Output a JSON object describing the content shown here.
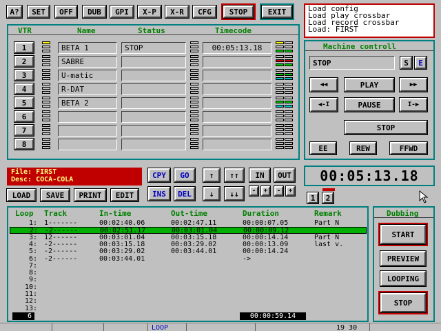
{
  "toolbar": {
    "help": "A?",
    "set": "SET",
    "off": "OFF",
    "dub": "DUB",
    "gpi": "GPI",
    "xp": "X-P",
    "xr": "X-R",
    "cfg": "CFG",
    "stop": "STOP",
    "exit": "EXIT"
  },
  "messages": [
    "Load config",
    "Load play crossbar",
    "Load record crossbar",
    "Load: FIRST"
  ],
  "vtr_table": {
    "headers": {
      "vtr": "VTR",
      "name": "Name",
      "status": "Status",
      "timecode": "Timecode"
    },
    "rows": [
      {
        "num": "1",
        "name": "BETA 1",
        "status": "STOP",
        "timecode": "00:05:13.18"
      },
      {
        "num": "2",
        "name": "SABRE",
        "status": "",
        "timecode": ""
      },
      {
        "num": "3",
        "name": "U-matic",
        "status": "",
        "timecode": ""
      },
      {
        "num": "4",
        "name": "R-DAT",
        "status": "",
        "timecode": ""
      },
      {
        "num": "5",
        "name": "BETA 2",
        "status": "",
        "timecode": ""
      },
      {
        "num": "6",
        "name": "",
        "status": "",
        "timecode": ""
      },
      {
        "num": "7",
        "name": "",
        "status": "",
        "timecode": ""
      },
      {
        "num": "8",
        "name": "",
        "status": "",
        "timecode": ""
      }
    ]
  },
  "machine": {
    "title": "Machine controll",
    "status": "STOP",
    "s_label": "S",
    "e_label": "E",
    "rew_icon": "◀◀",
    "play": "PLAY",
    "ffwd_icon": "▶▶",
    "step_back": "◀-I",
    "pause": "PAUSE",
    "step_fwd": "I-▶",
    "stop": "STOP",
    "ee": "EE",
    "rew": "REW",
    "ffwd": "FFWD"
  },
  "file": {
    "file_line": "File: FIRST",
    "desc_line": "Desc: COCA-COLA"
  },
  "edit_buttons": {
    "cpy": "CPY",
    "go": "GO",
    "ins": "INS",
    "del": "DEL",
    "up": "↑",
    "upup": "↑↑",
    "down": "↓",
    "downdown": "↓↓",
    "in": "IN",
    "out": "OUT",
    "minus1": "-",
    "plus1": "+",
    "minus2": "-",
    "plus2": "+",
    "load": "LOAD",
    "save": "SAVE",
    "print": "PRINT",
    "edit": "EDIT"
  },
  "timecode_big": "00:05:13.18",
  "pages": [
    "1",
    "2"
  ],
  "list": {
    "headers": {
      "loop": "Loop",
      "track": "Track",
      "in": "In-time",
      "out": "Out-time",
      "dur": "Duration",
      "remark": "Remark"
    },
    "rows": [
      {
        "num": "1:",
        "track": "1-------",
        "in": "00:02:40.06",
        "out": "00:02:47.11",
        "dur": "00:00:07.05",
        "remark": "Part N"
      },
      {
        "num": "2:",
        "track": "-2------",
        "in": "00:02:51.17",
        "out": "00:03:01.04",
        "dur": "00:00:09.12",
        "remark": ""
      },
      {
        "num": "3:",
        "track": "12------",
        "in": "00:03:01.04",
        "out": "00:03:15.18",
        "dur": "00:00:14.14",
        "remark": "Part N"
      },
      {
        "num": "4:",
        "track": "-2------",
        "in": "00:03:15.18",
        "out": "00:03:29.02",
        "dur": "00:00:13.09",
        "remark": "last v."
      },
      {
        "num": "5:",
        "track": "-2------",
        "in": "00:03:29.02",
        "out": "00:03:44.01",
        "dur": "00:00:14.24",
        "remark": ""
      },
      {
        "num": "6:",
        "track": "-2------",
        "in": "00:03:44.01",
        "out": "",
        "dur": "->",
        "remark": ""
      },
      {
        "num": "7:",
        "track": "",
        "in": "",
        "out": "",
        "dur": "",
        "remark": ""
      },
      {
        "num": "8:",
        "track": "",
        "in": "",
        "out": "",
        "dur": "",
        "remark": ""
      },
      {
        "num": "9:",
        "track": "",
        "in": "",
        "out": "",
        "dur": "",
        "remark": ""
      },
      {
        "num": "10:",
        "track": "",
        "in": "",
        "out": "",
        "dur": "",
        "remark": ""
      },
      {
        "num": "11:",
        "track": "",
        "in": "",
        "out": "",
        "dur": "",
        "remark": ""
      },
      {
        "num": "12:",
        "track": "",
        "in": "",
        "out": "",
        "dur": "",
        "remark": ""
      },
      {
        "num": "13:",
        "track": "",
        "in": "",
        "out": "",
        "dur": "",
        "remark": ""
      }
    ],
    "count": "6",
    "total": "00:00:59.14"
  },
  "dubbing": {
    "title": "Dubbing",
    "start": "START",
    "preview": "PREVIEW",
    "looping": "LOOPING",
    "stop": "STOP"
  },
  "status": {
    "mode": "LOOP",
    "clock": "19 30"
  },
  "colors": {
    "teal": "#008080",
    "red": "#c00000",
    "green": "#00b000",
    "blue": "#0000c0",
    "bg": "#c0c0c0"
  }
}
